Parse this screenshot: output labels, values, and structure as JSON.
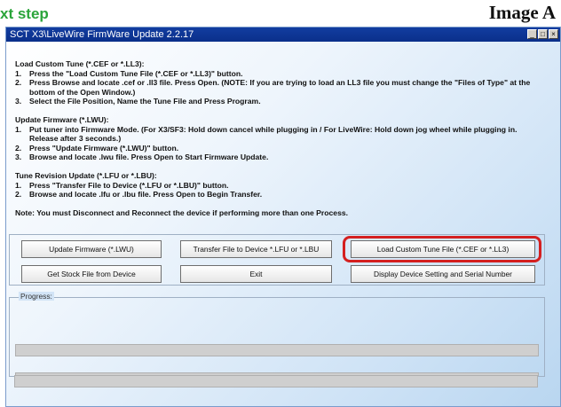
{
  "header": {
    "step_label": "xt step",
    "image_label": "Image A"
  },
  "window": {
    "title": "SCT X3\\LiveWire FirmWare Update  2.2.17",
    "controls": [
      "_",
      "□",
      "×"
    ]
  },
  "sections": [
    {
      "heading": "Load Custom Tune (*.CEF or *.LL3):",
      "steps": [
        {
          "num": "1.",
          "text": "Press the \"Load Custom Tune File (*.CEF or *.LL3)\" button."
        },
        {
          "num": "2.",
          "text": "Press Browse and locate .cef or .ll3 file.  Press Open. (NOTE: If you are trying to load an LL3 file you must change the \"Files of Type\" at the bottom of the Open Window.)"
        },
        {
          "num": "3.",
          "text": "Select the File Position, Name the Tune File and Press Program."
        }
      ]
    },
    {
      "heading": "Update Firmware (*.LWU):",
      "steps": [
        {
          "num": "1.",
          "text": "Put tuner into Firmware Mode. (For X3/SF3: Hold down cancel while plugging in / For LiveWire: Hold down jog wheel while plugging in. Release after 3 seconds.)"
        },
        {
          "num": "2.",
          "text": "Press \"Update Firmware (*.LWU)\" button."
        },
        {
          "num": "3.",
          "text": "Browse and locate .lwu file.  Press Open to Start Firmware Update."
        }
      ]
    },
    {
      "heading": "Tune Revision Update (*.LFU or *.LBU):",
      "steps": [
        {
          "num": "1.",
          "text": "Press \"Transfer File to Device  (*.LFU or *.LBU)\" button."
        },
        {
          "num": "2.",
          "text": "Browse and locate .lfu or .lbu file.  Press Open to Begin Transfer."
        }
      ]
    }
  ],
  "note": "Note: You must Disconnect and Reconnect the device if performing more than one Process.",
  "buttons": {
    "update_firmware": "Update Firmware (*.LWU)",
    "transfer_file": "Transfer File to Device *.LFU or *.LBU",
    "load_custom_tune": "Load Custom Tune File (*.CEF or *.LL3)",
    "get_stock_file": "Get Stock File from Device",
    "exit": "Exit",
    "display_settings": "Display Device Setting and Serial Number"
  },
  "progress": {
    "label": "Progress:"
  },
  "colors": {
    "highlight": "#d42020",
    "titlebar": "#0a2f8a",
    "step_label": "#2aa43a"
  }
}
